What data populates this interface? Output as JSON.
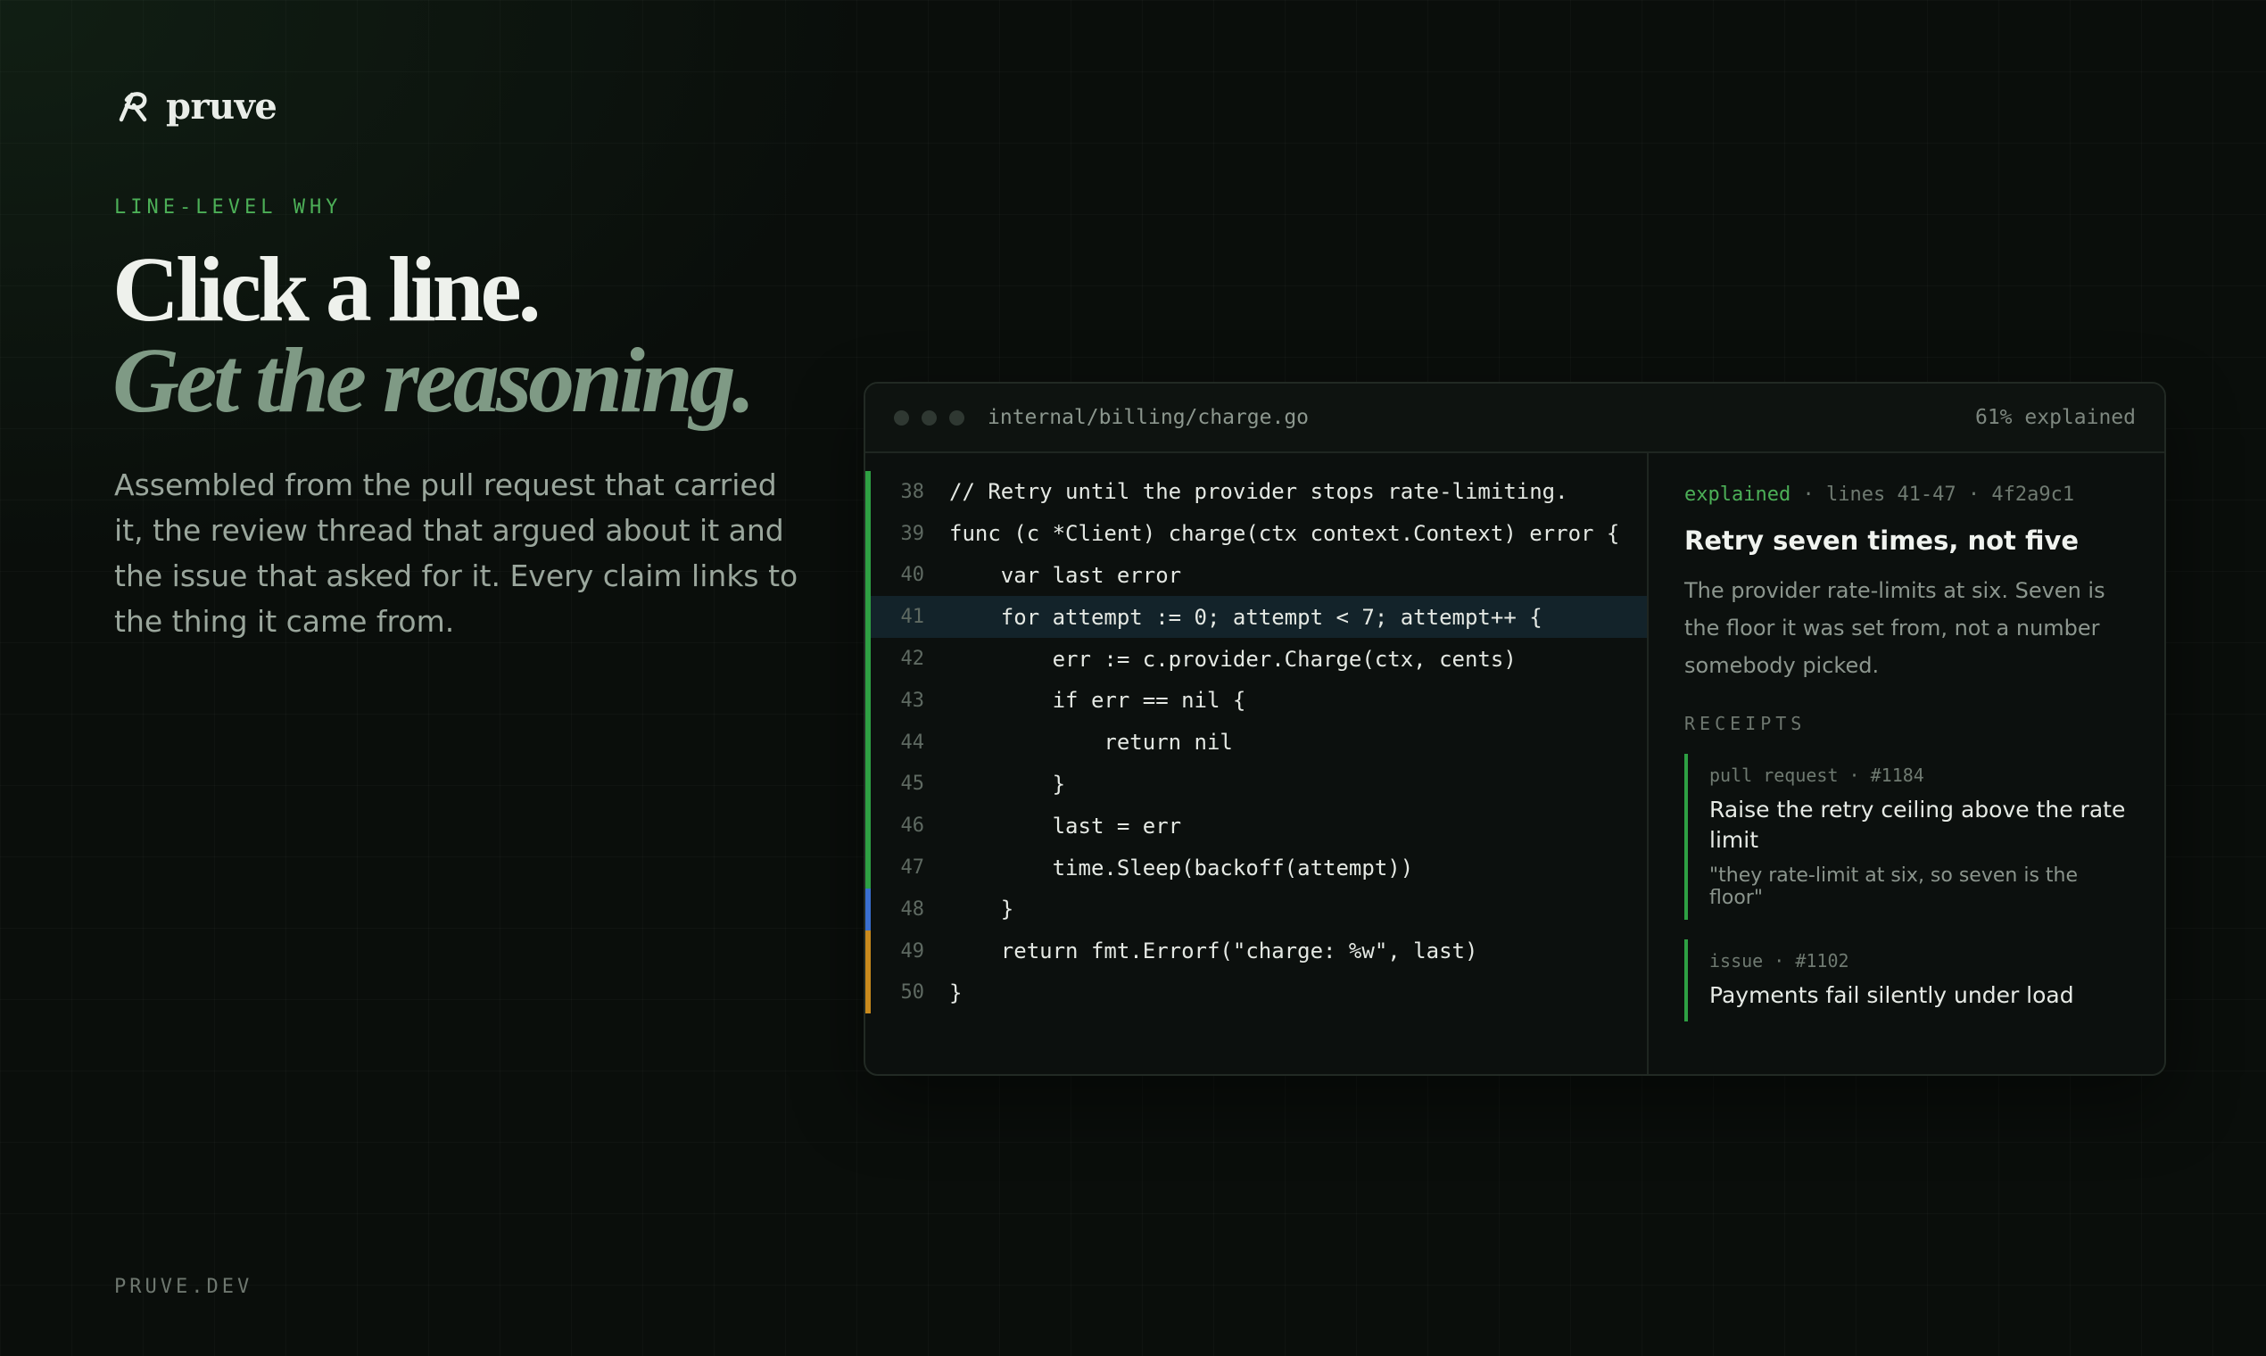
{
  "brand": {
    "name": "pruve",
    "logo_icon": "pruve-logo-icon"
  },
  "hero": {
    "eyebrow": "LINE-LEVEL WHY",
    "headline_line1": "Click a line.",
    "headline_line2": "Get the reasoning.",
    "lede": "Assembled from the pull request that carried it, the review thread that argued about it and the issue that asked for it. Every claim links to the thing it came from."
  },
  "footer": {
    "url": "PRUVE.DEV"
  },
  "editor": {
    "file_path": "internal/billing/charge.go",
    "explained_pct": "61% explained",
    "lines": [
      {
        "num": "38",
        "text": "// Retry until the provider stops rate-limiting.",
        "gutter": "green",
        "highlight": false
      },
      {
        "num": "39",
        "text": "func (c *Client) charge(ctx context.Context) error {",
        "gutter": "green",
        "highlight": false
      },
      {
        "num": "40",
        "text": "    var last error",
        "gutter": "green",
        "highlight": false
      },
      {
        "num": "41",
        "text": "    for attempt := 0; attempt < 7; attempt++ {",
        "gutter": "green",
        "highlight": true
      },
      {
        "num": "42",
        "text": "        err := c.provider.Charge(ctx, cents)",
        "gutter": "green",
        "highlight": false
      },
      {
        "num": "43",
        "text": "        if err == nil {",
        "gutter": "green",
        "highlight": false
      },
      {
        "num": "44",
        "text": "            return nil",
        "gutter": "green",
        "highlight": false
      },
      {
        "num": "45",
        "text": "        }",
        "gutter": "green",
        "highlight": false
      },
      {
        "num": "46",
        "text": "        last = err",
        "gutter": "green",
        "highlight": false
      },
      {
        "num": "47",
        "text": "        time.Sleep(backoff(attempt))",
        "gutter": "green",
        "highlight": false
      },
      {
        "num": "48",
        "text": "    }",
        "gutter": "blue",
        "highlight": false
      },
      {
        "num": "49",
        "text": "    return fmt.Errorf(\"charge: %w\", last)",
        "gutter": "amber",
        "highlight": false
      },
      {
        "num": "50",
        "text": "}",
        "gutter": "amber",
        "highlight": false
      }
    ]
  },
  "explanation": {
    "status": "explained",
    "lines": "lines 41-47",
    "commit": "4f2a9c1",
    "title": "Retry seven times, not five",
    "body": "The provider rate-limits at six. Seven is the floor it was set from, not a number somebody picked.",
    "receipts_label": "RECEIPTS",
    "receipts": [
      {
        "kind": "pull request",
        "ref": "#1184",
        "title": "Raise the retry ceiling above the rate limit",
        "quote": "\"they rate-limit at six, so seven is the floor\""
      },
      {
        "kind": "issue",
        "ref": "#1102",
        "title": "Payments fail silently under load",
        "quote": ""
      }
    ]
  },
  "colors": {
    "accent_green": "#4caf57",
    "gutter_green": "#2ea043",
    "gutter_blue": "#3a6fd0",
    "gutter_amber": "#c98a1d",
    "highlight_row": "#13232a"
  }
}
